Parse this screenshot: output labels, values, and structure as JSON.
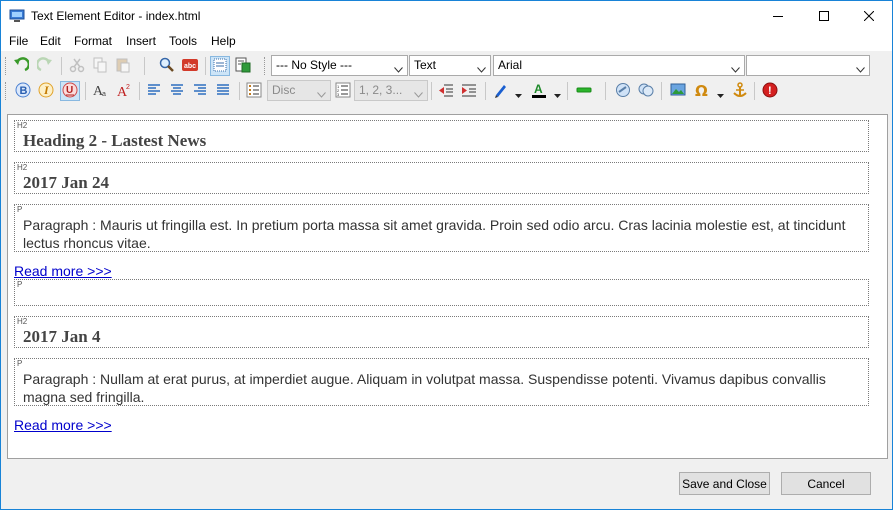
{
  "window": {
    "title": "Text Element Editor - index.html",
    "minimize_icon": "minimize-icon",
    "maximize_icon": "maximize-icon",
    "close_icon": "close-icon"
  },
  "menu": {
    "items": [
      "File",
      "Edit",
      "Format",
      "Insert",
      "Tools",
      "Help"
    ]
  },
  "toolbar": {
    "style_combo": "--- No Style ---",
    "type_combo": "Text",
    "font_combo": "Arial",
    "size_combo": "",
    "bullet_combo": "Disc",
    "numbering_combo": "1, 2, 3...",
    "colors": {
      "pen": "#1a5fd0",
      "font_color_bar": "#000000",
      "hr_green": "#2bb52b",
      "help_red": "#d42020"
    }
  },
  "editor": {
    "blocks": [
      {
        "tag": "H2",
        "text": "Heading 2 - Lastest News"
      },
      {
        "tag": "H2",
        "text": "2017 Jan 24"
      },
      {
        "tag": "P",
        "text": "Paragraph : Mauris ut fringilla est. In pretium porta massa sit amet gravida. Proin sed odio arcu. Cras lacinia molestie est, at tincidunt lectus rhoncus vitae."
      },
      {
        "tag": "P",
        "text": ""
      },
      {
        "tag": "H2",
        "text": "2017 Jan 4"
      },
      {
        "tag": "P",
        "text": "Paragraph : Nullam at erat purus, at imperdiet augue. Aliquam in volutpat massa. Suspendisse potenti. Vivamus dapibus convallis magna sed fringilla."
      }
    ],
    "links": [
      "Read more >>>",
      "Read more >>>"
    ]
  },
  "footer": {
    "save_label": "Save and Close",
    "cancel_label": "Cancel"
  }
}
